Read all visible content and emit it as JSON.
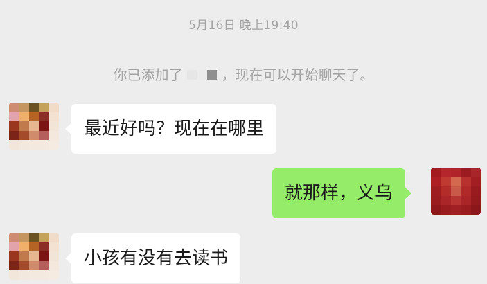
{
  "chat": {
    "timestamp": "5月16日 晚上19:40",
    "system": {
      "prefix": "你已添加了",
      "suffix": "，现在可以开始聊天了。"
    },
    "messages": [
      {
        "side": "left",
        "text": "最近好吗？现在在哪里"
      },
      {
        "side": "right",
        "text": "就那样，义乌"
      },
      {
        "side": "left",
        "text": "小孩有没有去读书"
      }
    ]
  },
  "colors": {
    "background": "#ededed",
    "incoming_bubble": "#ffffff",
    "outgoing_bubble": "#95ec69",
    "system_text": "#a3a3a3"
  }
}
